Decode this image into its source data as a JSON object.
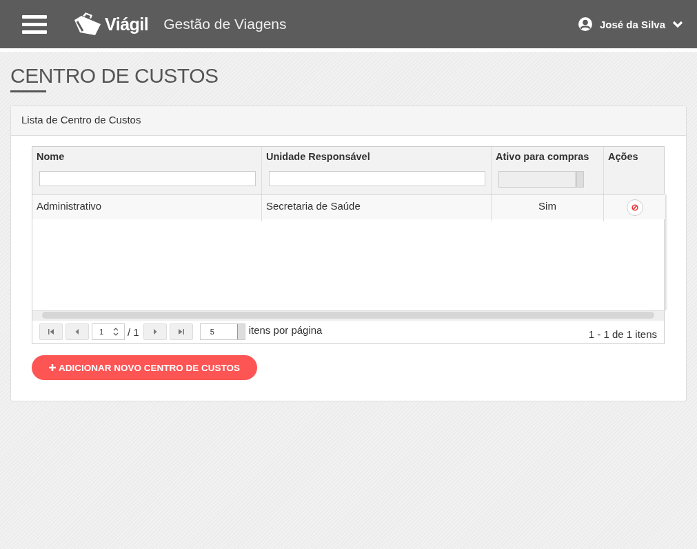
{
  "header": {
    "brand": "Viágil",
    "subtitle": "Gestão de Viagens",
    "user": "José da Silva"
  },
  "page_title": "CENTRO DE CUSTOS",
  "panel": {
    "title": "Lista de Centro de Custos",
    "grid": {
      "columns": [
        {
          "label": "Nome",
          "kind": "text"
        },
        {
          "label": "Unidade Responsável",
          "kind": "text"
        },
        {
          "label": "Ativo para compras",
          "kind": "select"
        },
        {
          "label": "Ações",
          "kind": "actions"
        }
      ],
      "rows": [
        {
          "cells": [
            "Administrativo",
            "Secretaria de Saúde",
            "Sim"
          ]
        }
      ],
      "pager": {
        "page": "1",
        "total": "/ 1",
        "page_size": "5",
        "per_page_label": "itens por página",
        "summary": "1 - 1 de 1 itens"
      }
    },
    "add_button": "ADICIONAR NOVO CENTRO DE CUSTOS"
  }
}
